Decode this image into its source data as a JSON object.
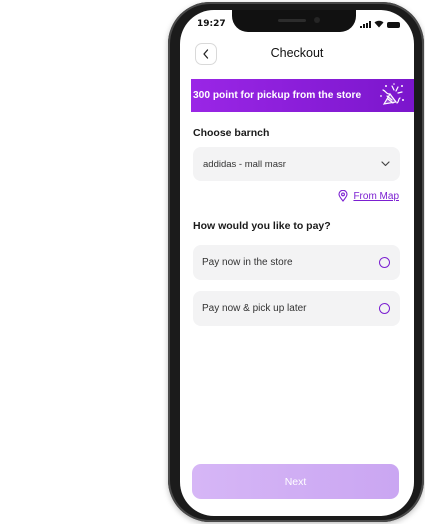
{
  "status_bar": {
    "time": "19:27"
  },
  "header": {
    "title": "Checkout"
  },
  "banner": {
    "text": "300 point for pickup from the store"
  },
  "branch": {
    "label": "Choose barnch",
    "selected": "addidas - mall masr",
    "map_link": "From Map"
  },
  "payment": {
    "label": "How would you like to pay?",
    "options": [
      {
        "label": "Pay now in the store"
      },
      {
        "label": "Pay now & pick up later"
      }
    ]
  },
  "footer": {
    "next_label": "Next"
  },
  "colors": {
    "accent": "#7b1fd1",
    "banner": "#8a1fdc",
    "button": "#d2b0f5"
  }
}
